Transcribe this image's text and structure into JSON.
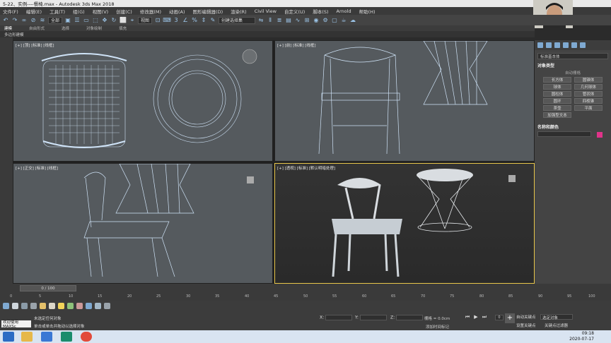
{
  "window": {
    "title": "5-22、实例----餐椅.max - Autodesk 3ds Max 2018"
  },
  "menu": [
    "文件(F)",
    "编辑(E)",
    "工具(T)",
    "组(G)",
    "视图(V)",
    "创建(C)",
    "修改器(M)",
    "动画(A)",
    "图形编辑器(D)",
    "渲染(R)",
    "Civil View",
    "自定义(U)",
    "脚本(S)",
    "Arnold",
    "帮助(H)"
  ],
  "toolbar": {
    "filter": "全部",
    "view": "视图",
    "selection_set": "创建选择集"
  },
  "ribbon": {
    "tabs": [
      "建模",
      "自由形式",
      "选择",
      "对象绘制",
      "填充"
    ],
    "sub": "多边形建模"
  },
  "viewports": [
    {
      "label": "[+] [顶] [标准] [线框]"
    },
    {
      "label": "[+] [前] [标准] [线框]"
    },
    {
      "label": "[+] [正交] [标准] [线框]"
    },
    {
      "label": "[+] [透视] [标准] [默认明暗处理]"
    }
  ],
  "command_panel": {
    "dropdown": "标准基本体",
    "object_type_title": "对象类型",
    "autogrid": "自动栅格",
    "buttons": [
      "长方体",
      "圆锥体",
      "球体",
      "几何球体",
      "圆柱体",
      "管状体",
      "圆环",
      "四棱锥",
      "茶壶",
      "平面",
      "加强型文本"
    ],
    "name_color_title": "名称和颜色",
    "object_color": "#e0338a"
  },
  "timeline": {
    "slider": "0 / 100",
    "ticks": [
      "0",
      "5",
      "10",
      "15",
      "20",
      "25",
      "30",
      "35",
      "40",
      "45",
      "50",
      "55",
      "60",
      "65",
      "70",
      "75",
      "80",
      "85",
      "90",
      "95",
      "100"
    ]
  },
  "status": {
    "selection": "未选定任何对象",
    "hint": "单击或单击并拖动以选择对象",
    "maxscript": "欢迎使用 MAXSc",
    "x_label": "X:",
    "y_label": "Y:",
    "z_label": "Z:",
    "grid": "栅格 = 0.0cm",
    "add_time_tag": "添加时间标记",
    "auto_key": "自动关键点",
    "set_key": "设置关键点",
    "key_filter_select": "选定对象",
    "key_filters": "关键点过滤器",
    "frame": "0"
  },
  "taskbar": {
    "time": "09:18",
    "date": "2020-07-17"
  }
}
